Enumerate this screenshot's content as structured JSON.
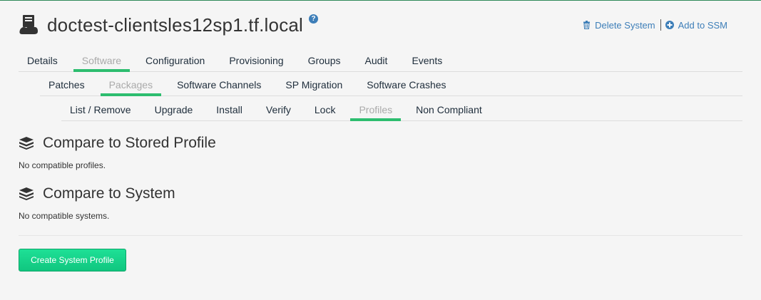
{
  "system": {
    "title": "doctest-clientsles12sp1.tf.local",
    "help": "?"
  },
  "actions": {
    "delete": "Delete System",
    "add_ssm": "Add to SSM"
  },
  "tabs": [
    "Details",
    "Software",
    "Configuration",
    "Provisioning",
    "Groups",
    "Audit",
    "Events"
  ],
  "subtabs": [
    "Patches",
    "Packages",
    "Software Channels",
    "SP Migration",
    "Software Crashes"
  ],
  "subsubtabs": [
    "List / Remove",
    "Upgrade",
    "Install",
    "Verify",
    "Lock",
    "Profiles",
    "Non Compliant"
  ],
  "sections": {
    "stored": {
      "title": "Compare to Stored Profile",
      "text": "No compatible profiles."
    },
    "system": {
      "title": "Compare to System",
      "text": "No compatible systems."
    }
  },
  "button": {
    "create": "Create System Profile"
  },
  "colors": {
    "accent": "#2dbd6f",
    "link": "#3d7eb8",
    "button": "#12d68b"
  }
}
